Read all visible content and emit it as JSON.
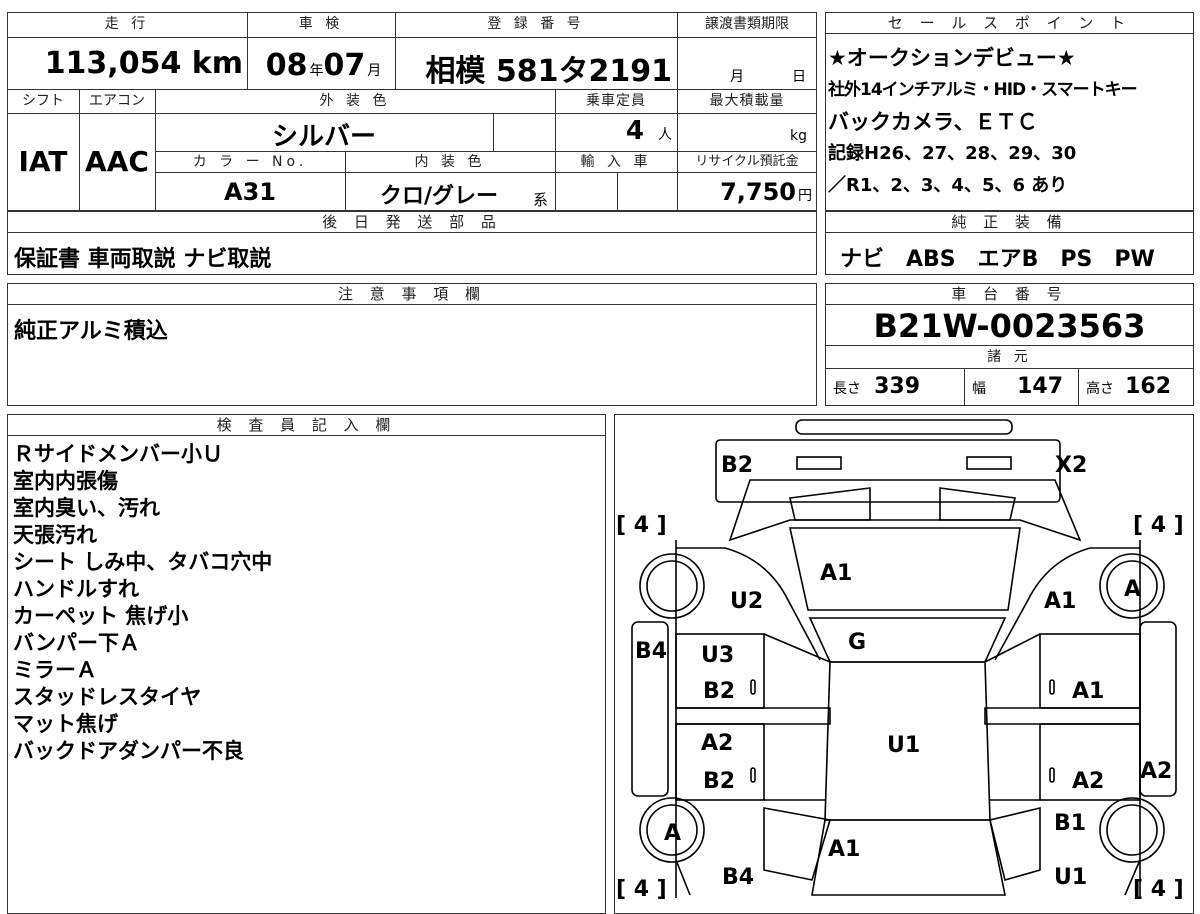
{
  "vehicle_info": {
    "labels": {
      "mileage": "走 行",
      "shaken": "車 検",
      "registration": "登 録 番 号",
      "transfer_deadline": "譲渡書類期限",
      "shift": "シフト",
      "aircon": "エアコン",
      "exterior_color": "外 装 色",
      "capacity": "乗車定員",
      "max_load": "最大積載量",
      "color_no": "カ ラ ー No.",
      "interior_color": "内 装 色",
      "import": "輸 入 車",
      "recycle": "リサイクル預託金",
      "later_parts": "後 日 発 送 部 品"
    },
    "mileage": "113,054",
    "mileage_unit": "km",
    "shaken_year": "08",
    "shaken_year_unit": "年",
    "shaken_month": "07",
    "shaken_month_unit": "月",
    "registration": "相模 581タ2191",
    "deadline_month_unit": "月",
    "deadline_day_unit": "日",
    "shift": "IAT",
    "aircon": "AAC",
    "exterior_color": "シルバー",
    "capacity": "4",
    "capacity_unit": "人",
    "max_load_unit": "kg",
    "color_no": "A31",
    "interior_color": "クロ/グレー",
    "interior_suffix": "系",
    "recycle": "7,750",
    "recycle_unit": "円",
    "later_parts": "保証書 車両取説 ナビ取説"
  },
  "sales_points": {
    "header": "セ ー ル ス ポ イ ン ト",
    "lines": [
      "★オークションデビュー★",
      "社外14インチアルミ・HID・スマートキー",
      "バックカメラ、ＥＴＣ",
      "記録H26、27、28、29、30",
      "／R1、2、3、4、5、6 あり"
    ]
  },
  "genuine_equipment": {
    "header": "純 正 装 備",
    "value": "ナビ　ABS　エアB　PS　PW"
  },
  "cautions": {
    "header": "注 意 事 項 欄",
    "value": "純正アルミ積込"
  },
  "chassis": {
    "header": "車 台 番 号",
    "value": "B21W-0023563"
  },
  "specs": {
    "header": "諸 元",
    "length_label": "長さ",
    "length": "339",
    "width_label": "幅",
    "width": "147",
    "height_label": "高さ",
    "height": "162"
  },
  "inspector": {
    "header": "検 査 員 記 入 欄",
    "notes": [
      "Ｒサイドメンバー小Ｕ",
      "室内内張傷",
      "室内臭い、汚れ",
      "天張汚れ",
      "シート しみ中、タバコ穴中",
      "ハンドルすれ",
      "カーペット 焦げ小",
      "バンパー下Ａ",
      "ミラーＡ",
      "スタッドレスタイヤ",
      "マット焦げ",
      "バックドアダンパー不良"
    ]
  },
  "diagram": {
    "labels": {
      "front_left": "B2",
      "front_right": "X2",
      "tire_fl": "[ 4 ]",
      "tire_fr": "[ 4 ]",
      "tire_rl": "[ 4 ]",
      "tire_rr": "[ 4 ]",
      "hood": "A1",
      "fender_left": "U2",
      "fender_right": "A1",
      "wheel_fr": "A",
      "windshield": "G",
      "left_side": "B4",
      "door_fl_upper": "U3",
      "door_fl_lower": "B2",
      "door_fr": "A1",
      "roof": "U1",
      "door_rl_upper": "A2",
      "door_rl_lower": "B2",
      "door_rr": "A2",
      "right_side": "A2",
      "wheel_rl": "A",
      "quarter_right": "B1",
      "trunk": "A1",
      "rear_left": "B4",
      "rear_right": "U1"
    }
  }
}
